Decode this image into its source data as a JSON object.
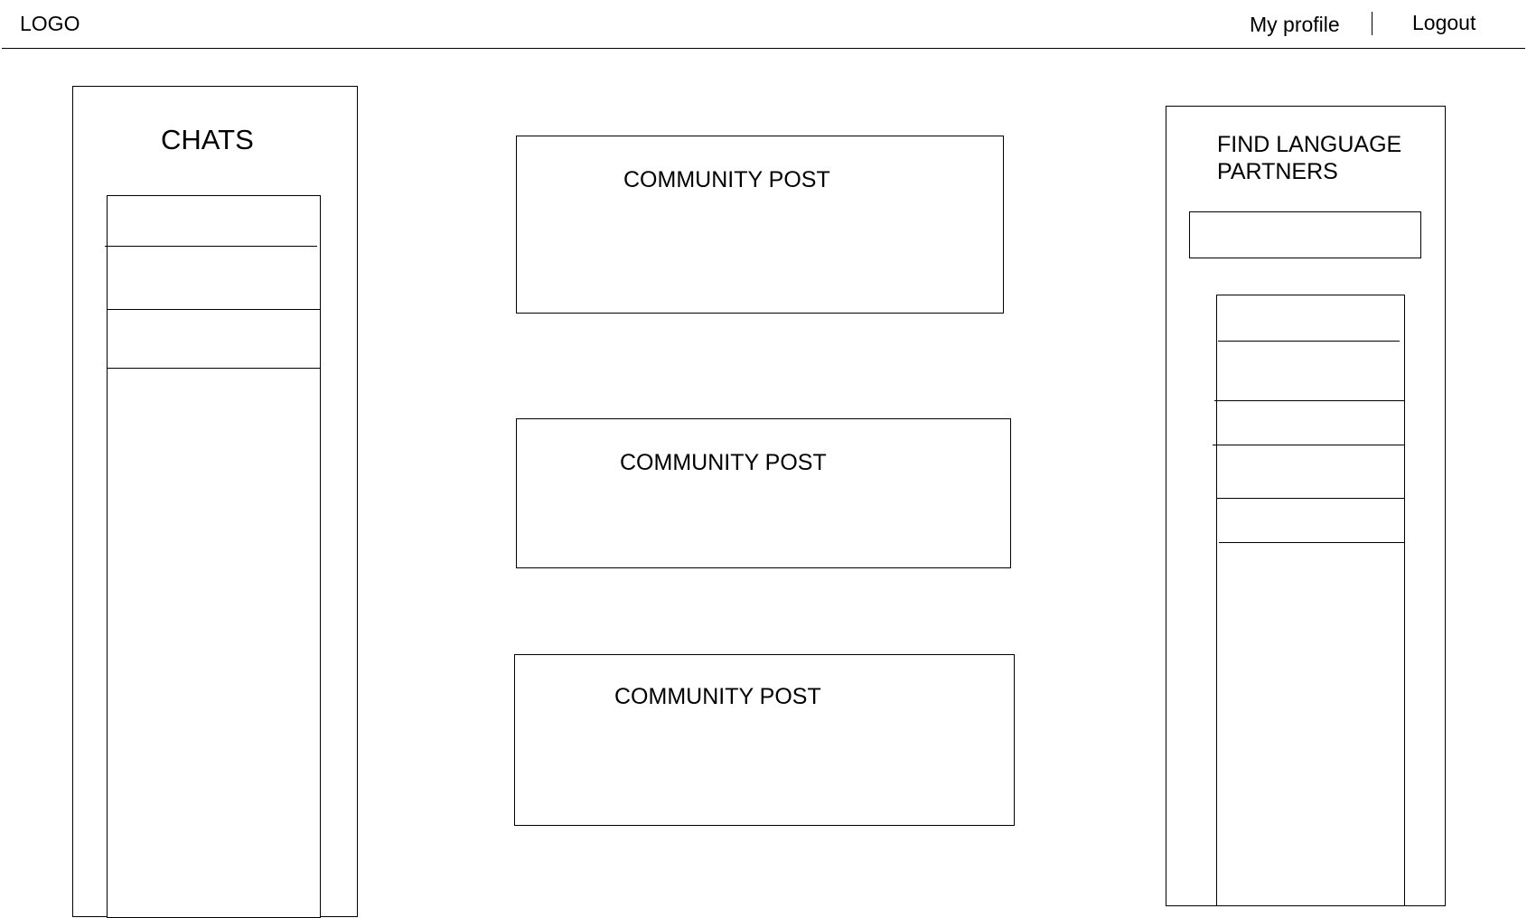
{
  "header": {
    "logo": "LOGO",
    "my_profile": "My profile",
    "logout": "Logout"
  },
  "chats": {
    "title": "CHATS",
    "items": [
      "",
      "",
      ""
    ]
  },
  "feed": {
    "posts": [
      {
        "title": "COMMUNITY POST"
      },
      {
        "title": "COMMUNITY POST"
      },
      {
        "title": "COMMUNITY POST"
      }
    ]
  },
  "partners": {
    "title_line1": "FIND LANGUAGE",
    "title_line2": "PARTNERS",
    "search_value": "",
    "items": [
      "",
      "",
      "",
      "",
      ""
    ]
  }
}
